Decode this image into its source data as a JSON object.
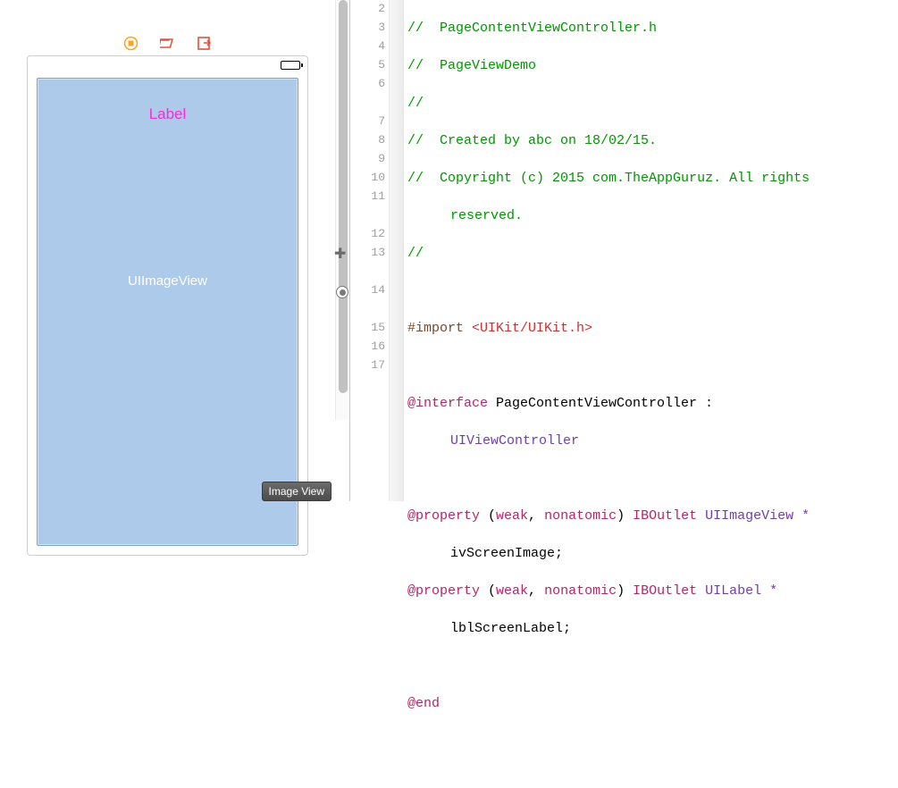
{
  "ib": {
    "label_text": "Label",
    "placeholder_text": "UIImageView",
    "tooltip": "Image View"
  },
  "gutter": {
    "lines": [
      "2",
      "3",
      "4",
      "5",
      "6",
      "",
      "7",
      "8",
      "9",
      "10",
      "11",
      "",
      "12",
      "13",
      "",
      "14",
      "",
      "15",
      "16",
      "17"
    ]
  },
  "code": {
    "l2a": "//  ",
    "l2b": "PageContentViewController.h",
    "l3a": "//  ",
    "l3b": "PageViewDemo",
    "l4": "//",
    "l5a": "//  ",
    "l5b": "Created by abc on 18/02/15.",
    "l6a": "//  ",
    "l6b": "Copyright (c) 2015 com.TheAppGuruz. All rights",
    "l6c": "reserved.",
    "l7": "//",
    "l9a": "#import ",
    "l9b": "<UIKit/UIKit.h>",
    "l11a": "@interface",
    "l11b": " PageContentViewController :",
    "l11c": "UIViewController",
    "l13a": "@property",
    "l13b": " (",
    "l13c": "weak",
    "l13d": ", ",
    "l13e": "nonatomic",
    "l13f": ") ",
    "l13g": "IBOutlet",
    "l13h": " UIImageView *",
    "l13i": "ivScreenImage;",
    "l14a": "@property",
    "l14b": " (",
    "l14c": "weak",
    "l14d": ", ",
    "l14e": "nonatomic",
    "l14f": ") ",
    "l14g": "IBOutlet",
    "l14h": " UILabel *",
    "l14i": "lblScreenLabel;",
    "l16": "@end"
  }
}
